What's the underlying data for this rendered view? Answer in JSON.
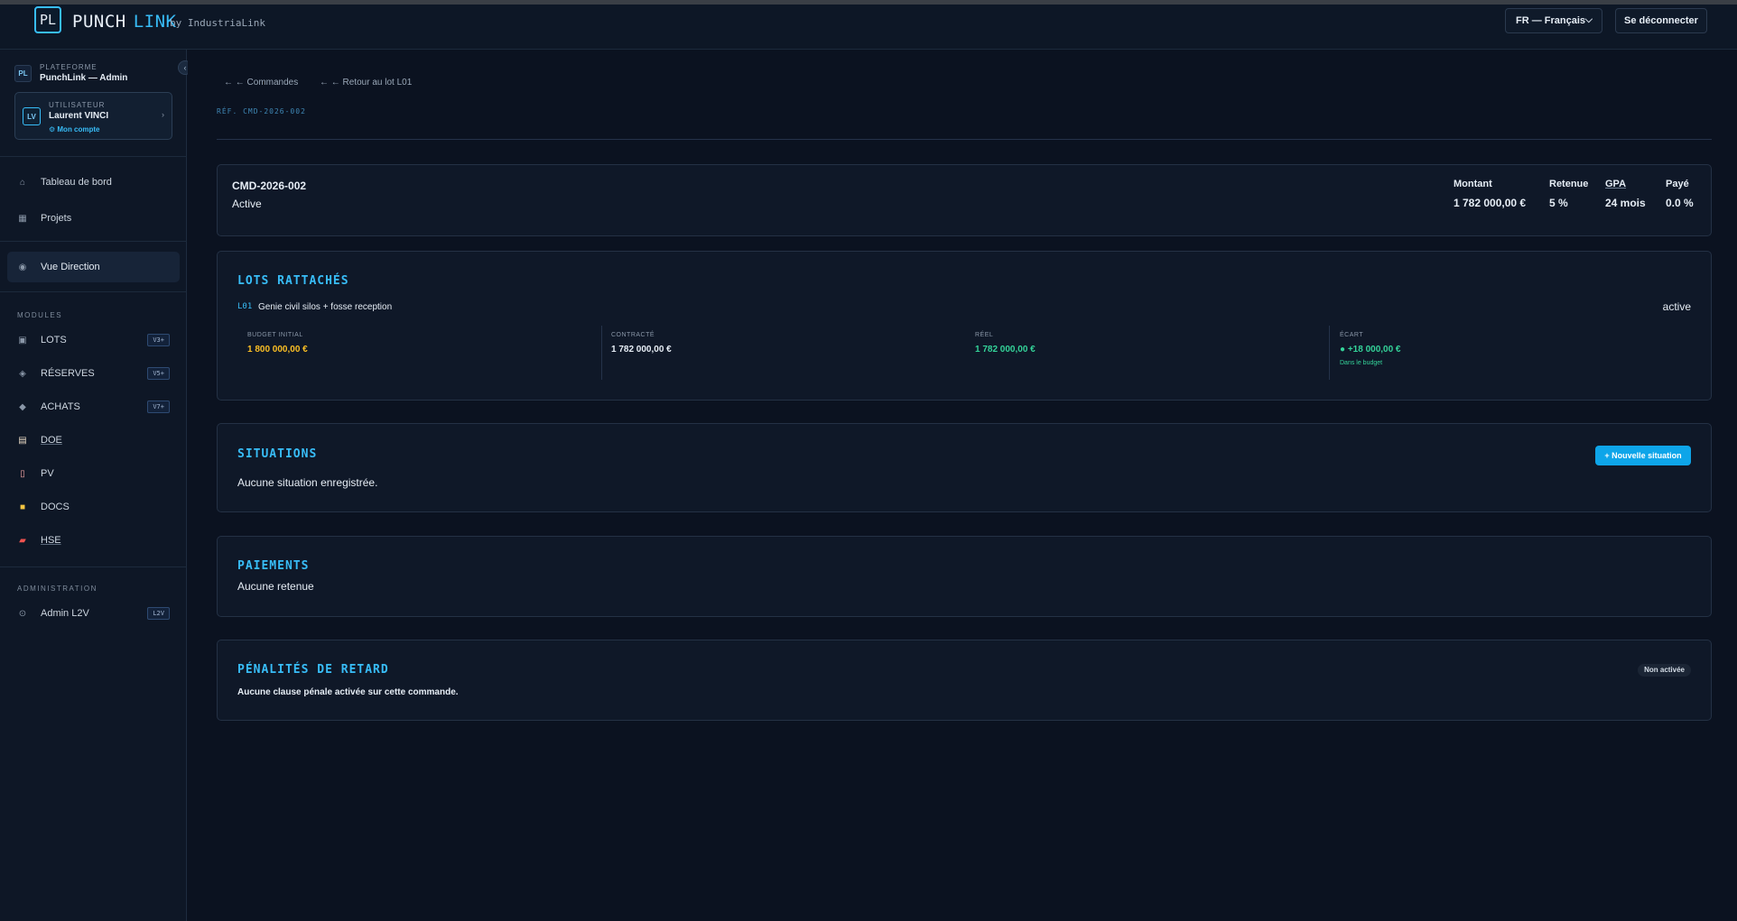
{
  "header": {
    "logo_text": "PL",
    "brand_part1": "PUNCH",
    "brand_part2": "LINK",
    "byline": "by IndustriaLink",
    "language": "FR — Français",
    "logout_label": "Se déconnecter"
  },
  "sidebar": {
    "collapse_glyph": "‹",
    "platform": {
      "icon": "PL",
      "label": "PLATEFORME",
      "name": "PunchLink — Admin"
    },
    "user": {
      "initials": "LV",
      "label": "UTILISATEUR",
      "name": "Laurent VINCI",
      "account_link": "⚙ Mon compte"
    },
    "nav": [
      {
        "label": "Tableau de bord",
        "icon": "home-icon"
      },
      {
        "label": "Projets",
        "icon": "grid-icon"
      },
      {
        "label": "Vue Direction",
        "icon": "eye-icon"
      }
    ],
    "modules_label": "MODULES",
    "modules": [
      {
        "label": "LOTS",
        "badge": "V3+",
        "icon": "lots-icon"
      },
      {
        "label": "RÉSERVES",
        "badge": "V5+",
        "icon": "reserves-icon"
      },
      {
        "label": "ACHATS",
        "badge": "V7+",
        "icon": "achats-icon"
      },
      {
        "label": "DOE",
        "icon": "clipboard-icon"
      },
      {
        "label": "PV",
        "icon": "document-icon"
      },
      {
        "label": "DOCS",
        "icon": "folder-icon"
      },
      {
        "label": "HSE",
        "icon": "safety-vest-icon"
      }
    ],
    "admin_label": "ADMINISTRATION",
    "admin_item": {
      "label": "Admin L2V",
      "badge": "L2V",
      "icon": "admin-icon"
    }
  },
  "breadcrumbs": [
    "← ← Commandes",
    "← ← Retour au lot L01"
  ],
  "ref": "RÉF. CMD-2026-002",
  "order": {
    "code": "CMD-2026-002",
    "status": "Active",
    "metrics": [
      {
        "label": "Montant",
        "value": "1 782 000,00 €"
      },
      {
        "label": "Retenue",
        "value": "5 %"
      },
      {
        "label": "GPA",
        "value": "24 mois"
      },
      {
        "label": "Payé",
        "value": "0.0 %"
      }
    ]
  },
  "lots": {
    "title": "LOTS RATTACHÉS",
    "code": "L01",
    "name": "Genie civil silos + fosse reception",
    "status": "active",
    "budget": [
      {
        "label": "BUDGET INITIAL",
        "value": "1 800 000,00 €"
      },
      {
        "label": "CONTRACTÉ",
        "value": "1 782 000,00 €"
      },
      {
        "label": "RÉEL",
        "value": "1 782 000,00 €"
      },
      {
        "label": "ÉCART",
        "value": "+18 000,00 €",
        "note": "Dans le budget"
      }
    ]
  },
  "situations": {
    "title": "SITUATIONS",
    "new_button": "+ Nouvelle situation",
    "empty": "Aucune situation enregistrée."
  },
  "paiements": {
    "title": "PAIEMENTS",
    "empty": "Aucune retenue"
  },
  "penalites": {
    "title": "PÉNALITÉS DE RETARD",
    "badge": "Non activée",
    "empty": "Aucune clause pénale activée sur cette commande."
  },
  "colors": {
    "accent": "#38bdf8",
    "budget_initial": "#fbbf24",
    "positive": "#34d399"
  }
}
